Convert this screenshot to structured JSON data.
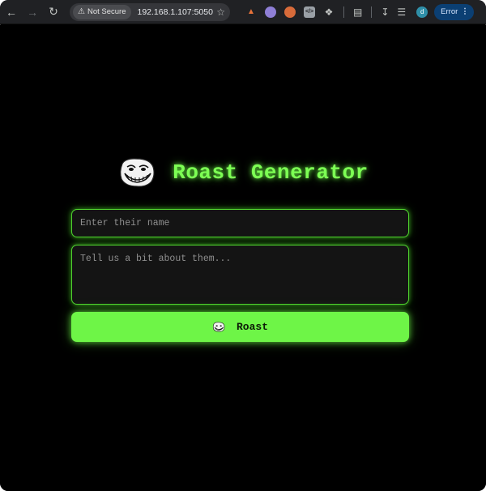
{
  "browser": {
    "security_label": "Not Secure",
    "url": "192.168.1.107:5050",
    "error_label": "Error",
    "profile_initial": "d",
    "icons": {
      "back": "arrow-left-icon",
      "forward": "arrow-right-icon",
      "reload": "reload-icon",
      "warning": "warning-icon",
      "bookmark": "star-icon",
      "extensions": "puzzle-icon",
      "download": "download-icon",
      "media": "media-queue-icon",
      "menu": "kebab-menu-icon"
    }
  },
  "app": {
    "title": "Roast Generator",
    "logo_icon": "troll-face-icon",
    "name_placeholder": "Enter their name",
    "about_placeholder": "Tell us a bit about them...",
    "roast_button_label": "Roast",
    "colors": {
      "accent": "#6ef547",
      "title": "#7dff54",
      "background": "#000000",
      "field_bg": "#141414"
    }
  }
}
